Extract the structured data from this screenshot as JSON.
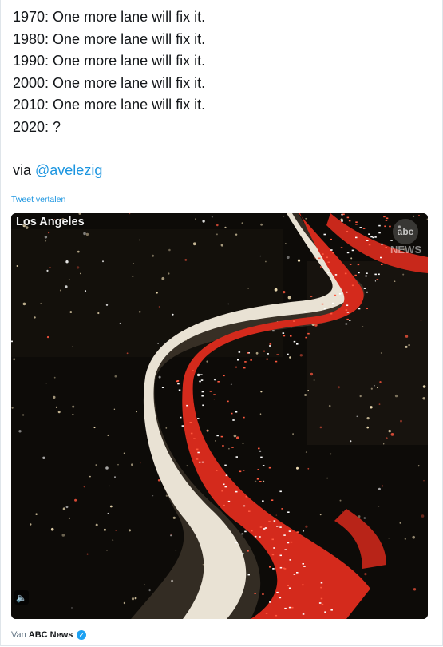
{
  "tweet": {
    "lines": [
      "1970: One more lane will fix it.",
      "1980: One more lane will fix it.",
      "1990: One more lane will fix it.",
      "2000: One more lane will fix it.",
      "2010: One more lane will fix it.",
      "2020: ?"
    ],
    "via_prefix": "via ",
    "mention": "@avelezig",
    "translate_link": "Tweet vertalen"
  },
  "media": {
    "location_label": "Los Angeles",
    "network_logo": "abc",
    "watermark": "NEWS",
    "speaker_icon": "speaker-icon"
  },
  "source": {
    "prefix": "Van",
    "name": "ABC News",
    "verified_icon": "verified-badge-icon"
  },
  "colors": {
    "link": "#1b95e0",
    "text": "#14171a",
    "muted": "#657786"
  }
}
